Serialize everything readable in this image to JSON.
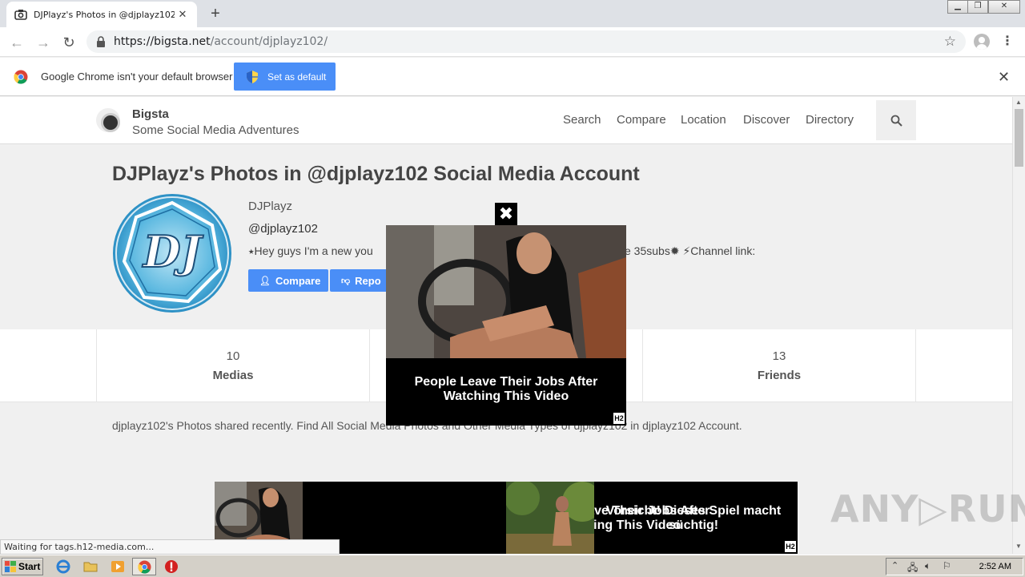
{
  "browser": {
    "tab_title": "DJPlayz's Photos in @djplayz102 Social Media Account",
    "url_host": "https://bigsta.net",
    "url_path": "/account/djplayz102/",
    "infobar_message": "Google Chrome isn't your default browser",
    "infobar_button": "Set as default",
    "status_text": "Waiting for tags.h12-media.com..."
  },
  "site": {
    "brand_name": "Bigsta",
    "brand_tagline": "Some Social Media Adventures",
    "nav": [
      "Search",
      "Compare",
      "Location",
      "Discover",
      "Directory"
    ],
    "page_title": "DJPlayz's Photos in @djplayz102 Social Media Account",
    "profile": {
      "name": "DJPlayz",
      "handle": "@djplayz102",
      "bio_start": "⭑Hey guys I'm a new you",
      "bio_end": "ve 35subs✹ ⚡Channel link:",
      "compare_label": "Compare",
      "report_label": "Repo"
    },
    "stats": [
      {
        "value": "10",
        "label": "Medias"
      },
      {
        "value": "13",
        "label": "Friends"
      }
    ],
    "description": "djplayz102's Photos shared recently. Find All Social Media Photos and Other Media Types of djplayz102 in djplayz102 Account.",
    "banner_ad": {
      "text_left": "People Leave Their Jobs After Watching This Video",
      "text_right": "Vorsicht! Dieses Spiel macht süchtig!"
    }
  },
  "popup_ad": {
    "close_glyph": "✖",
    "headline": "People Leave Their Jobs After Watching This Video",
    "badge": "H2"
  },
  "watermark": "ANY▷RUN",
  "taskbar": {
    "start_label": "Start",
    "clock": "2:52 AM"
  },
  "colors": {
    "accent_blue": "#4a8ef7",
    "tab_strip": "#dee1e6",
    "taskbar": "#d4d0c8"
  }
}
